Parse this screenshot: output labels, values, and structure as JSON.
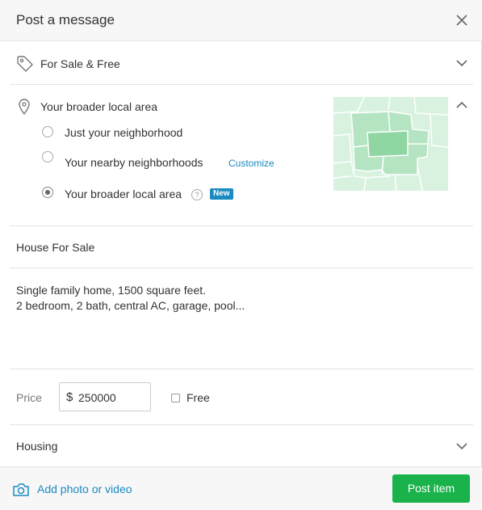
{
  "header": {
    "title": "Post a message"
  },
  "category": {
    "label": "For Sale & Free"
  },
  "audience": {
    "title": "Your broader local area",
    "options": [
      {
        "label": "Just your neighborhood",
        "checked": false
      },
      {
        "label": "Your nearby neighborhoods",
        "checked": false,
        "link": "Customize"
      },
      {
        "label": "Your broader local area",
        "checked": true,
        "badge": "New",
        "help": "?"
      }
    ]
  },
  "post": {
    "title": "House For Sale",
    "description": "Single family home, 1500 square feet.\n2 bedroom, 2 bath, central AC, garage, pool..."
  },
  "price": {
    "label": "Price",
    "currency": "$",
    "value": "250000",
    "free_label": "Free",
    "free_checked": false
  },
  "housing": {
    "label": "Housing"
  },
  "footer": {
    "add_photo_label": "Add photo or video",
    "post_button_label": "Post item"
  },
  "colors": {
    "accent_link": "#1a8ac0",
    "post_button": "#19b24b",
    "map_light": "#d9f2e0",
    "map_mid": "#b4e4c2",
    "map_dark": "#8fd6a3"
  }
}
